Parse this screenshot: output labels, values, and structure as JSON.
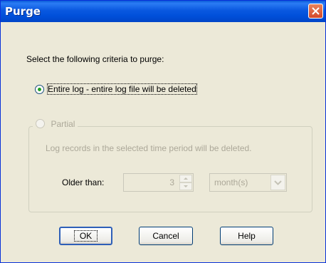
{
  "window": {
    "title": "Purge"
  },
  "dialog": {
    "prompt": "Select the following criteria to purge:",
    "option_entire": {
      "label": "Entire log - entire log file will be deleted",
      "selected": true
    },
    "option_partial": {
      "label": "Partial",
      "selected": false,
      "enabled": false
    },
    "partial_description": "Log records in the selected time period will be deleted.",
    "older_than": {
      "label": "Older than:",
      "value": "3",
      "unit": "month(s)"
    }
  },
  "buttons": {
    "ok": "OK",
    "cancel": "Cancel",
    "help": "Help"
  },
  "icons": {
    "close": "close-icon",
    "spin_up": "arrow-up-icon",
    "spin_down": "arrow-down-icon",
    "dropdown": "chevron-down-icon"
  },
  "colors": {
    "title_bar": "#0a58e0",
    "dialog_bg": "#ece9d8",
    "disabled_text": "#aca899",
    "close_button": "#d4482a",
    "radio_dot": "#21a121"
  }
}
